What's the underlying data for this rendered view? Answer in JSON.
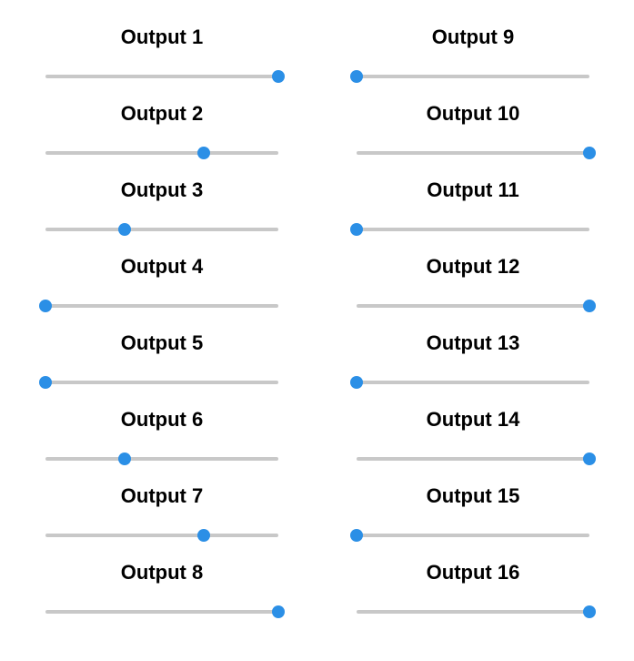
{
  "colors": {
    "track": "#c8c8c8",
    "knob": "#2b8fe6",
    "label": "#000000"
  },
  "outputs": [
    {
      "label": "Output 1",
      "value": 1.0
    },
    {
      "label": "Output 2",
      "value": 0.68
    },
    {
      "label": "Output 3",
      "value": 0.34
    },
    {
      "label": "Output 4",
      "value": 0.0
    },
    {
      "label": "Output 5",
      "value": 0.0
    },
    {
      "label": "Output 6",
      "value": 0.34
    },
    {
      "label": "Output 7",
      "value": 0.68
    },
    {
      "label": "Output 8",
      "value": 1.0
    },
    {
      "label": "Output 9",
      "value": 0.0
    },
    {
      "label": "Output 10",
      "value": 1.0
    },
    {
      "label": "Output 11",
      "value": 0.0
    },
    {
      "label": "Output 12",
      "value": 1.0
    },
    {
      "label": "Output 13",
      "value": 0.0
    },
    {
      "label": "Output 14",
      "value": 1.0
    },
    {
      "label": "Output 15",
      "value": 0.0
    },
    {
      "label": "Output 16",
      "value": 1.0
    }
  ]
}
